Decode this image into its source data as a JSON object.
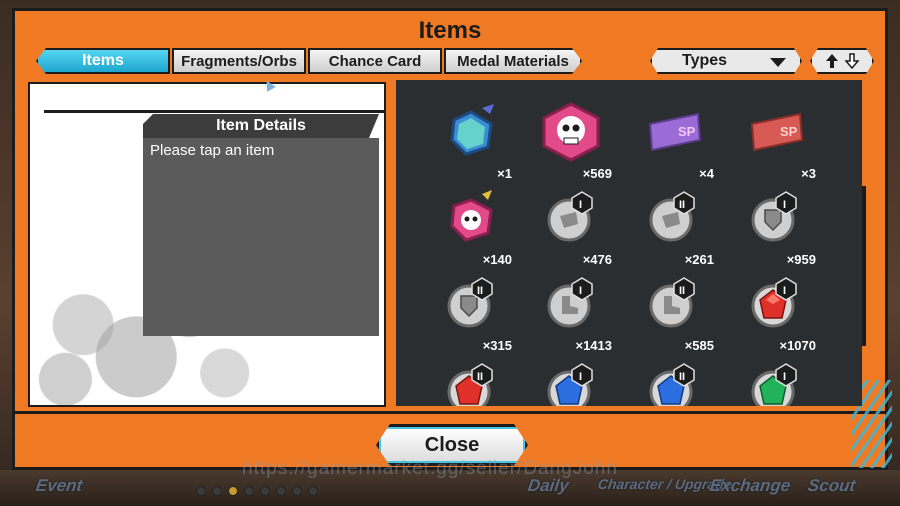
{
  "window": {
    "title": "Items"
  },
  "tabs": [
    {
      "label": "Items",
      "active": true
    },
    {
      "label": "Fragments/Orbs",
      "active": false
    },
    {
      "label": "Chance Card",
      "active": false
    },
    {
      "label": "Medal Materials",
      "active": false
    }
  ],
  "filter": {
    "types_label": "Types"
  },
  "details": {
    "header": "Item Details",
    "placeholder": "Please tap an item"
  },
  "items": [
    {
      "icon": "blue-fragment-icon",
      "count": "×1"
    },
    {
      "icon": "pink-skull-medal-icon",
      "count": "×569"
    },
    {
      "icon": "purple-sp-ticket-icon",
      "count": "×4"
    },
    {
      "icon": "red-sp-ticket-icon",
      "count": "×3"
    },
    {
      "icon": "pink-skull-fragment-icon",
      "count": "×140"
    },
    {
      "icon": "silver-fist-tier1-icon",
      "count": "×476"
    },
    {
      "icon": "silver-fist-tier2-icon",
      "count": "×261"
    },
    {
      "icon": "silver-shield-tier1-icon",
      "count": "×959"
    },
    {
      "icon": "silver-shield-tier2-icon",
      "count": "×315"
    },
    {
      "icon": "silver-boot-tier1-icon",
      "count": "×1413"
    },
    {
      "icon": "silver-boot-tier2-icon",
      "count": "×585"
    },
    {
      "icon": "red-gem-tier1-icon",
      "count": "×1070"
    },
    {
      "icon": "red-gem-tier2-icon",
      "count": ""
    },
    {
      "icon": "blue-gem-tier1-icon",
      "count": ""
    },
    {
      "icon": "blue-gem-tier2-icon",
      "count": ""
    },
    {
      "icon": "green-gem-tier1-icon",
      "count": ""
    }
  ],
  "footer": {
    "close_label": "Close"
  },
  "background_nav": [
    "Event",
    "Daily",
    "Character / Upgrade",
    "Exchange",
    "Scout"
  ],
  "watermark": "https://gamermarket.gg/seller/DangJohn",
  "colors": {
    "frame": "#f07a24",
    "active_tab": "#1ea6cf",
    "panel": "#2b2e31"
  }
}
